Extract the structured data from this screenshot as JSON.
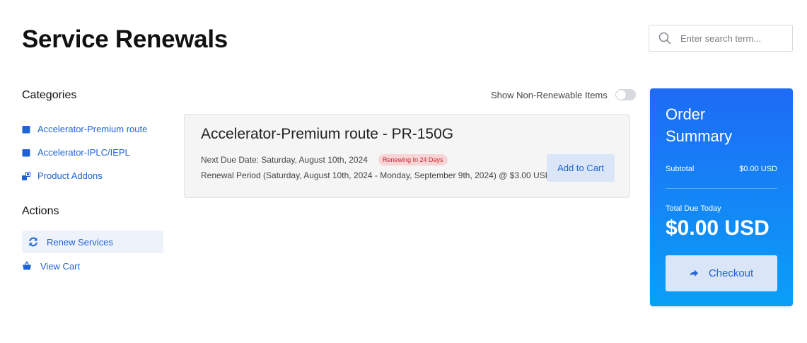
{
  "page": {
    "title": "Service Renewals"
  },
  "search": {
    "placeholder": "Enter search term..."
  },
  "categories": {
    "heading": "Categories",
    "items": [
      {
        "label": "Accelerator-Premium route",
        "icon": "box-icon"
      },
      {
        "label": "Accelerator-IPLC/IEPL",
        "icon": "box-icon"
      },
      {
        "label": "Product Addons",
        "icon": "cubes-icon"
      }
    ]
  },
  "actions": {
    "heading": "Actions",
    "items": [
      {
        "label": "Renew Services",
        "icon": "sync-icon",
        "active": true
      },
      {
        "label": "View Cart",
        "icon": "basket-icon",
        "active": false
      }
    ]
  },
  "filter": {
    "label": "Show Non-Renewable Items",
    "enabled": false
  },
  "service": {
    "title": "Accelerator-Premium route - PR-150G",
    "due_date": "Next Due Date: Saturday, August 10th, 2024",
    "badge": "Renewing In 24 Days",
    "period": "Renewal Period (Saturday, August 10th, 2024 - Monday, September 9th, 2024) @ $3.00 USD",
    "button_label": "Add to Cart"
  },
  "summary": {
    "title": "Order Summary",
    "subtotal_label": "Subtotal",
    "subtotal_value": "$0.00 USD",
    "total_label": "Total Due Today",
    "total_value": "$0.00 USD",
    "checkout_label": "Checkout"
  },
  "colors": {
    "accent": "#1f63d6",
    "summary_gradient_top": "#1e6bf5",
    "summary_gradient_bottom": "#0a9ff7",
    "badge_bg": "#f9d4d6",
    "badge_text": "#c1272d"
  }
}
